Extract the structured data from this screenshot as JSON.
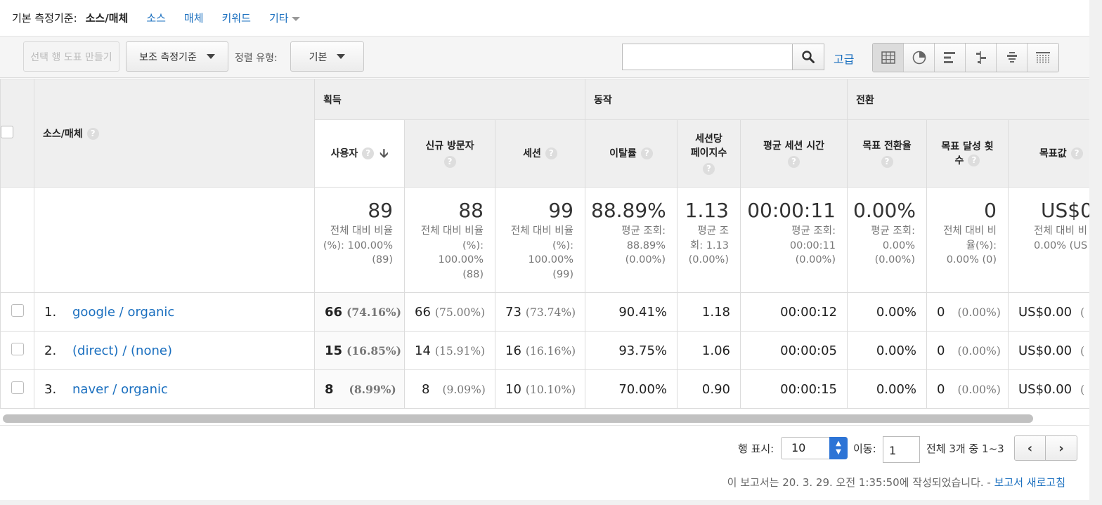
{
  "dimension_bar": {
    "label": "기본 측정기준:",
    "current": "소스/매체",
    "options": [
      "소스",
      "매체",
      "키워드"
    ],
    "other": "기타"
  },
  "toolbar": {
    "plot_rows": "선택 행 도표 만들기",
    "secondary_dimension": "보조 측정기준",
    "sort_type_label": "정렬 유형:",
    "sort_type_value": "기본",
    "search_value": "",
    "advanced": "고급"
  },
  "table": {
    "dimension_header": "소스/매체",
    "groups": {
      "acquisition": "획득",
      "behavior": "동작",
      "conversion": "전환"
    },
    "columns": {
      "users": "사용자",
      "new_users_line1": "신규 방문자",
      "sessions": "세션",
      "bounce_rate": "이탈률",
      "pages_per_session_line1": "세션당",
      "pages_per_session_line2": "페이지수",
      "avg_session_duration": "평균 세션 시간",
      "goal_conversion_rate": "목표 전환율",
      "goal_completions_line1": "목표 달성 횟",
      "goal_completions_line2": "수",
      "goal_value": "목표값"
    },
    "help_glyph": "?",
    "totals": {
      "users": {
        "value": "89",
        "sub": [
          "전체 대비 비율",
          "(%): 100.00%",
          "(89)"
        ]
      },
      "new_users": {
        "value": "88",
        "sub": [
          "전체 대비 비율",
          "(%):",
          "100.00%",
          "(88)"
        ]
      },
      "sessions": {
        "value": "99",
        "sub": [
          "전체 대비 비율",
          "(%):",
          "100.00%",
          "(99)"
        ]
      },
      "bounce_rate": {
        "value": "88.89%",
        "sub": [
          "평균 조회:",
          "88.89%",
          "(0.00%)"
        ]
      },
      "pages_per_session": {
        "value": "1.13",
        "sub": [
          "평균 조",
          "회: 1.13",
          "(0.00%)"
        ]
      },
      "avg_session_duration": {
        "value": "00:00:11",
        "sub": [
          "평균 조회:",
          "00:00:11",
          "(0.00%)"
        ]
      },
      "goal_conversion_rate": {
        "value": "0.00%",
        "sub": [
          "평균 조회:",
          "0.00%",
          "(0.00%)"
        ]
      },
      "goal_completions": {
        "value": "0",
        "sub": [
          "전체 대비 비",
          "율(%):",
          "0.00% (0)"
        ]
      },
      "goal_value": {
        "value": "US$0",
        "sub": [
          "전체 대비 비",
          "0.00% (US"
        ]
      }
    },
    "rows": [
      {
        "index": "1.",
        "source": "google / organic",
        "users": "66",
        "users_pct": "(74.16%)",
        "new_users": "66",
        "new_users_pct": "(75.00%)",
        "sessions": "73",
        "sessions_pct": "(73.74%)",
        "bounce_rate": "90.41%",
        "pages_per_session": "1.18",
        "avg_session_duration": "00:00:12",
        "goal_conversion_rate": "0.00%",
        "goal_completions": "0",
        "goal_completions_pct": "(0.00%)",
        "goal_value": "US$0.00"
      },
      {
        "index": "2.",
        "source": "(direct) / (none)",
        "users": "15",
        "users_pct": "(16.85%)",
        "new_users": "14",
        "new_users_pct": "(15.91%)",
        "sessions": "16",
        "sessions_pct": "(16.16%)",
        "bounce_rate": "93.75%",
        "pages_per_session": "1.06",
        "avg_session_duration": "00:00:05",
        "goal_conversion_rate": "0.00%",
        "goal_completions": "0",
        "goal_completions_pct": "(0.00%)",
        "goal_value": "US$0.00"
      },
      {
        "index": "3.",
        "source": "naver / organic",
        "users": "8",
        "users_pct": "(8.99%)",
        "new_users": "8",
        "new_users_pct": "(9.09%)",
        "sessions": "10",
        "sessions_pct": "(10.10%)",
        "bounce_rate": "70.00%",
        "pages_per_session": "0.90",
        "avg_session_duration": "00:00:15",
        "goal_conversion_rate": "0.00%",
        "goal_completions": "0",
        "goal_completions_pct": "(0.00%)",
        "goal_value": "US$0.00"
      }
    ]
  },
  "footer": {
    "rows_label": "행 표시:",
    "rows_value": "10",
    "goto_label": "이동:",
    "goto_value": "1",
    "range": "전체 3개 중 1~3",
    "created": "이 보고서는 20. 3. 29. 오전 1:35:50에 작성되었습니다. -",
    "refresh": "보고서 새로고침"
  },
  "colors": {
    "link": "#1a6fbf",
    "header_bg": "#efefef",
    "spinner": "#2d74d6"
  }
}
